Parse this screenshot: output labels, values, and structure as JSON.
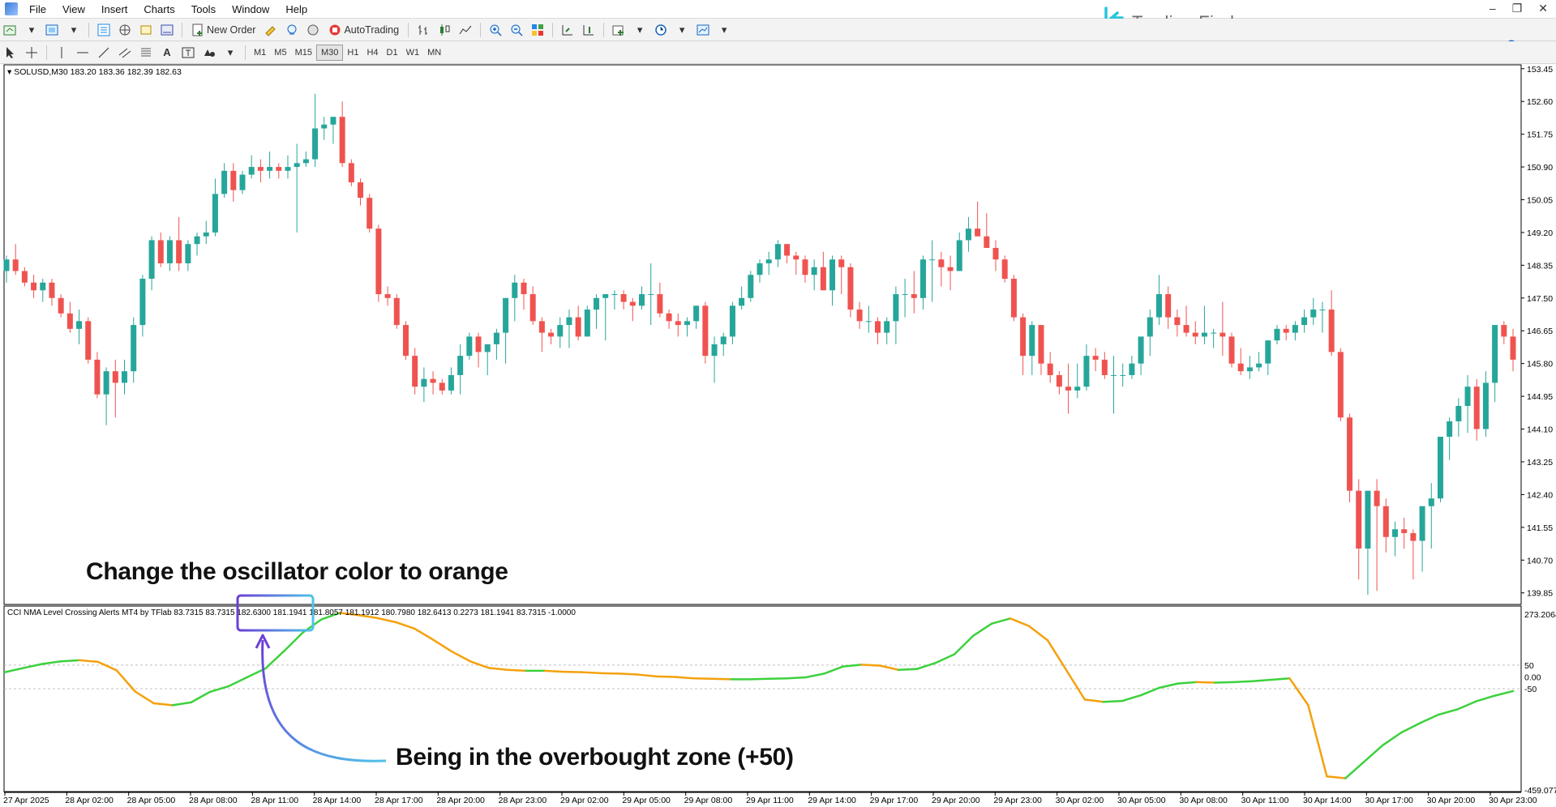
{
  "menu": {
    "items": [
      "File",
      "View",
      "Insert",
      "Charts",
      "Tools",
      "Window",
      "Help"
    ],
    "window_controls": [
      "–",
      "❐",
      "✕"
    ]
  },
  "toolbar": {
    "new_order_label": "New Order",
    "autotrading_label": "AutoTrading",
    "timeframes": [
      "M1",
      "M5",
      "M15",
      "M30",
      "H1",
      "H4",
      "D1",
      "W1",
      "MN"
    ],
    "active_timeframe": "M30"
  },
  "brand": {
    "name": "Trading Finder",
    "accent": "#26c6da"
  },
  "notifications": {
    "count": "1"
  },
  "chart_data": [
    {
      "type": "candlestick",
      "header": "SOLUSD,M30  183.20 183.36 182.39 182.63",
      "price_ticks": [
        "153.45",
        "152.60",
        "151.75",
        "150.90",
        "150.05",
        "149.20",
        "148.35",
        "147.50",
        "146.65",
        "145.80",
        "144.95",
        "144.10",
        "143.25",
        "142.40",
        "141.55",
        "140.70",
        "139.85"
      ],
      "ylim": [
        139.55,
        153.55
      ],
      "colors": {
        "up": "#26a69a",
        "down": "#ef5350"
      },
      "candles": [
        [
          148.2,
          148.6,
          147.9,
          148.5
        ],
        [
          148.5,
          148.9,
          148.1,
          148.2
        ],
        [
          148.2,
          148.3,
          147.8,
          147.9
        ],
        [
          147.9,
          148.1,
          147.5,
          147.7
        ],
        [
          147.7,
          148.0,
          147.4,
          147.9
        ],
        [
          147.9,
          148.0,
          147.3,
          147.5
        ],
        [
          147.5,
          147.6,
          147.0,
          147.1
        ],
        [
          147.1,
          147.4,
          146.6,
          146.7
        ],
        [
          146.7,
          147.2,
          146.3,
          146.9
        ],
        [
          146.9,
          147.0,
          145.8,
          145.9
        ],
        [
          145.9,
          146.1,
          144.9,
          145.0
        ],
        [
          145.0,
          145.7,
          144.2,
          145.6
        ],
        [
          145.6,
          145.9,
          144.4,
          145.3
        ],
        [
          145.3,
          145.9,
          145.0,
          145.6
        ],
        [
          145.6,
          147.0,
          145.3,
          146.8
        ],
        [
          146.8,
          148.1,
          146.5,
          148.0
        ],
        [
          148.0,
          149.1,
          147.7,
          149.0
        ],
        [
          149.0,
          149.2,
          148.3,
          148.4
        ],
        [
          148.4,
          149.1,
          148.2,
          149.0
        ],
        [
          149.0,
          149.6,
          148.2,
          148.4
        ],
        [
          148.4,
          149.0,
          148.2,
          148.9
        ],
        [
          148.9,
          149.2,
          148.6,
          149.1
        ],
        [
          149.1,
          149.5,
          148.9,
          149.2
        ],
        [
          149.2,
          150.6,
          149.1,
          150.2
        ],
        [
          150.2,
          151.0,
          150.1,
          150.8
        ],
        [
          150.8,
          151.0,
          150.0,
          150.3
        ],
        [
          150.3,
          150.8,
          150.2,
          150.7
        ],
        [
          150.7,
          151.2,
          150.6,
          150.9
        ],
        [
          150.9,
          151.1,
          150.5,
          150.8
        ],
        [
          150.8,
          151.3,
          150.6,
          150.9
        ],
        [
          150.9,
          151.0,
          150.6,
          150.8
        ],
        [
          150.8,
          151.2,
          150.6,
          150.9
        ],
        [
          150.9,
          151.5,
          149.2,
          151.0
        ],
        [
          151.0,
          151.3,
          150.9,
          151.1
        ],
        [
          151.1,
          152.8,
          150.9,
          151.9
        ],
        [
          151.9,
          152.2,
          151.6,
          152.0
        ],
        [
          152.0,
          152.2,
          151.5,
          152.2
        ],
        [
          152.2,
          152.6,
          150.9,
          151.0
        ],
        [
          151.0,
          151.1,
          150.4,
          150.5
        ],
        [
          150.5,
          150.6,
          149.9,
          150.1
        ],
        [
          150.1,
          150.2,
          149.2,
          149.3
        ],
        [
          149.3,
          149.4,
          147.4,
          147.6
        ],
        [
          147.6,
          147.8,
          147.3,
          147.5
        ],
        [
          147.5,
          147.6,
          146.7,
          146.8
        ],
        [
          146.8,
          146.9,
          145.9,
          146.0
        ],
        [
          146.0,
          146.2,
          145.0,
          145.2
        ],
        [
          145.2,
          145.7,
          144.8,
          145.4
        ],
        [
          145.4,
          145.6,
          145.0,
          145.3
        ],
        [
          145.3,
          145.4,
          145.0,
          145.1
        ],
        [
          145.1,
          145.7,
          145.0,
          145.5
        ],
        [
          145.5,
          146.3,
          145.0,
          146.0
        ],
        [
          146.0,
          146.6,
          145.9,
          146.5
        ],
        [
          146.5,
          146.6,
          145.7,
          146.1
        ],
        [
          146.1,
          146.3,
          145.5,
          146.3
        ],
        [
          146.3,
          146.7,
          145.9,
          146.6
        ],
        [
          146.6,
          147.5,
          145.8,
          147.5
        ],
        [
          147.5,
          148.1,
          146.9,
          147.9
        ],
        [
          147.9,
          148.0,
          147.2,
          147.6
        ],
        [
          147.6,
          147.8,
          146.8,
          146.9
        ],
        [
          146.9,
          147.0,
          146.1,
          146.6
        ],
        [
          146.6,
          146.7,
          146.3,
          146.5
        ],
        [
          146.5,
          147.0,
          146.2,
          146.8
        ],
        [
          146.8,
          147.2,
          146.2,
          147.0
        ],
        [
          147.0,
          147.3,
          146.4,
          146.5
        ],
        [
          146.5,
          147.3,
          146.5,
          147.2
        ],
        [
          147.2,
          147.6,
          146.7,
          147.5
        ],
        [
          147.5,
          147.6,
          146.4,
          147.6
        ],
        [
          147.6,
          147.7,
          147.2,
          147.6
        ],
        [
          147.6,
          147.7,
          147.2,
          147.4
        ],
        [
          147.4,
          147.5,
          146.9,
          147.3
        ],
        [
          147.3,
          147.8,
          147.2,
          147.6
        ],
        [
          147.6,
          148.4,
          146.8,
          147.6
        ],
        [
          147.6,
          147.9,
          147.0,
          147.1
        ],
        [
          147.1,
          147.2,
          146.7,
          146.9
        ],
        [
          146.9,
          147.1,
          146.5,
          146.8
        ],
        [
          146.8,
          147.0,
          146.5,
          146.9
        ],
        [
          146.9,
          147.3,
          146.7,
          147.3
        ],
        [
          147.3,
          147.4,
          145.8,
          146.0
        ],
        [
          146.0,
          146.5,
          145.3,
          146.3
        ],
        [
          146.3,
          146.6,
          146.0,
          146.5
        ],
        [
          146.5,
          147.4,
          146.3,
          147.3
        ],
        [
          147.3,
          147.8,
          147.2,
          147.5
        ],
        [
          147.5,
          148.2,
          147.4,
          148.1
        ],
        [
          148.1,
          148.5,
          147.9,
          148.4
        ],
        [
          148.4,
          148.7,
          148.1,
          148.5
        ],
        [
          148.5,
          149.0,
          148.3,
          148.9
        ],
        [
          148.9,
          148.9,
          148.4,
          148.6
        ],
        [
          148.6,
          148.7,
          148.1,
          148.5
        ],
        [
          148.5,
          148.6,
          147.9,
          148.1
        ],
        [
          148.1,
          148.5,
          147.7,
          148.3
        ],
        [
          148.3,
          148.7,
          147.7,
          147.7
        ],
        [
          147.7,
          148.6,
          147.3,
          148.5
        ],
        [
          148.5,
          148.6,
          147.6,
          148.3
        ],
        [
          148.3,
          148.4,
          147.0,
          147.2
        ],
        [
          147.2,
          147.4,
          146.7,
          146.9
        ],
        [
          146.9,
          147.3,
          146.6,
          146.9
        ],
        [
          146.9,
          147.0,
          146.3,
          146.6
        ],
        [
          146.6,
          147.0,
          146.3,
          146.9
        ],
        [
          146.9,
          147.8,
          146.3,
          147.6
        ],
        [
          147.6,
          148.0,
          147.0,
          147.6
        ],
        [
          147.6,
          148.2,
          147.1,
          147.5
        ],
        [
          147.5,
          148.6,
          147.2,
          148.5
        ],
        [
          148.5,
          149.0,
          147.4,
          148.5
        ],
        [
          148.5,
          148.7,
          147.8,
          148.3
        ],
        [
          148.3,
          148.6,
          147.7,
          148.2
        ],
        [
          148.2,
          149.2,
          148.2,
          149.0
        ],
        [
          149.0,
          149.6,
          148.7,
          149.3
        ],
        [
          149.3,
          150.0,
          149.1,
          149.1
        ],
        [
          149.1,
          149.7,
          148.8,
          148.8
        ],
        [
          148.8,
          149.0,
          148.2,
          148.5
        ],
        [
          148.5,
          148.6,
          147.9,
          148.0
        ],
        [
          148.0,
          148.1,
          146.9,
          147.0
        ],
        [
          147.0,
          147.1,
          145.5,
          146.0
        ],
        [
          146.0,
          146.9,
          145.5,
          146.8
        ],
        [
          146.8,
          146.8,
          145.5,
          145.8
        ],
        [
          145.8,
          146.1,
          145.3,
          145.5
        ],
        [
          145.5,
          145.6,
          145.0,
          145.2
        ],
        [
          145.2,
          145.8,
          144.5,
          145.1
        ],
        [
          145.1,
          145.8,
          144.9,
          145.2
        ],
        [
          145.2,
          146.3,
          145.1,
          146.0
        ],
        [
          146.0,
          146.2,
          145.6,
          145.9
        ],
        [
          145.9,
          146.1,
          145.4,
          145.5
        ],
        [
          145.5,
          146.0,
          144.5,
          145.5
        ],
        [
          145.5,
          145.8,
          145.2,
          145.5
        ],
        [
          145.5,
          146.0,
          145.4,
          145.8
        ],
        [
          145.8,
          146.2,
          145.5,
          146.5
        ],
        [
          146.5,
          147.2,
          146.0,
          147.0
        ],
        [
          147.0,
          148.1,
          146.8,
          147.6
        ],
        [
          147.6,
          147.8,
          146.7,
          147.0
        ],
        [
          147.0,
          147.2,
          146.5,
          146.8
        ],
        [
          146.8,
          147.3,
          146.5,
          146.6
        ],
        [
          146.6,
          146.9,
          146.3,
          146.5
        ],
        [
          146.5,
          147.3,
          146.3,
          146.6
        ],
        [
          146.6,
          146.7,
          146.2,
          146.6
        ],
        [
          146.6,
          147.4,
          146.0,
          146.5
        ],
        [
          146.5,
          146.6,
          145.7,
          145.8
        ],
        [
          145.8,
          146.2,
          145.5,
          145.6
        ],
        [
          145.6,
          146.0,
          145.4,
          145.7
        ],
        [
          145.7,
          146.1,
          145.6,
          145.8
        ],
        [
          145.8,
          146.4,
          145.5,
          146.4
        ],
        [
          146.4,
          146.8,
          146.3,
          146.7
        ],
        [
          146.7,
          146.8,
          146.4,
          146.6
        ],
        [
          146.6,
          146.9,
          146.4,
          146.8
        ],
        [
          146.8,
          147.2,
          146.6,
          147.0
        ],
        [
          147.0,
          147.5,
          146.8,
          147.2
        ],
        [
          147.2,
          147.4,
          146.6,
          147.2
        ],
        [
          147.2,
          147.7,
          146.0,
          146.1
        ],
        [
          146.1,
          146.2,
          144.3,
          144.4
        ],
        [
          144.4,
          144.5,
          142.2,
          142.5
        ],
        [
          142.5,
          142.8,
          140.2,
          141.0
        ],
        [
          141.0,
          142.2,
          139.8,
          142.5
        ],
        [
          142.5,
          142.8,
          139.9,
          142.1
        ],
        [
          142.1,
          142.3,
          140.9,
          141.3
        ],
        [
          141.3,
          141.7,
          140.8,
          141.5
        ],
        [
          141.5,
          141.8,
          141.0,
          141.4
        ],
        [
          141.4,
          141.5,
          140.2,
          141.2
        ],
        [
          141.2,
          141.9,
          140.4,
          142.1
        ],
        [
          142.1,
          142.7,
          141.0,
          142.3
        ],
        [
          142.3,
          143.3,
          142.2,
          143.9
        ],
        [
          143.9,
          144.4,
          143.3,
          144.3
        ],
        [
          144.3,
          144.9,
          143.9,
          144.7
        ],
        [
          144.7,
          145.5,
          144.0,
          145.2
        ],
        [
          145.2,
          145.4,
          143.8,
          144.1
        ],
        [
          144.1,
          145.6,
          143.9,
          145.3
        ],
        [
          145.3,
          146.8,
          144.8,
          146.8
        ],
        [
          146.8,
          146.9,
          146.3,
          146.5
        ],
        [
          146.5,
          146.7,
          145.6,
          145.9
        ]
      ]
    },
    {
      "type": "line",
      "header": "CCI NMA Level Crossing Alerts MT4 by TFlab 83.7315 83.7315 182.6300 181.1941 181.8057 181.1912 180.7980 182.6413 0.2273 181.1941 83.7315 -1.0000",
      "ylim": [
        -459.077,
        273.2064
      ],
      "levels": [
        50,
        0.0,
        -50
      ],
      "level_labels": [
        "50",
        "0.00",
        "-50"
      ],
      "tick_labels": [
        "273.2064",
        "50",
        "0.00",
        "-50",
        "-459.077"
      ],
      "colors": {
        "rising": "#3dd13d",
        "falling": "#f4a10d"
      },
      "values": [
        20,
        38,
        55,
        66,
        71,
        64,
        28,
        -62,
        -112,
        -120,
        -108,
        -64,
        -40,
        -2,
        36,
        110,
        188,
        244,
        272,
        262,
        250,
        232,
        205,
        158,
        108,
        66,
        38,
        30,
        26,
        26,
        22,
        20,
        16,
        14,
        10,
        2,
        0,
        -6,
        -8,
        -10,
        -10,
        -8,
        -6,
        -2,
        14,
        44,
        52,
        48,
        30,
        34,
        60,
        96,
        174,
        226,
        248,
        216,
        156,
        30,
        -96,
        -106,
        -102,
        -78,
        -46,
        -28,
        -22,
        -24,
        -22,
        -18,
        -12,
        -6,
        -120,
        -422,
        -430,
        -360,
        -290,
        -236,
        -196,
        -160,
        -138,
        -104,
        -80,
        -60
      ]
    }
  ],
  "x_axis": [
    "27 Apr 2025",
    "28 Apr 02:00",
    "28 Apr 05:00",
    "28 Apr 08:00",
    "28 Apr 11:00",
    "28 Apr 14:00",
    "28 Apr 17:00",
    "28 Apr 20:00",
    "28 Apr 23:00",
    "29 Apr 02:00",
    "29 Apr 05:00",
    "29 Apr 08:00",
    "29 Apr 11:00",
    "29 Apr 14:00",
    "29 Apr 17:00",
    "29 Apr 20:00",
    "29 Apr 23:00",
    "30 Apr 02:00",
    "30 Apr 05:00",
    "30 Apr 08:00",
    "30 Apr 11:00",
    "30 Apr 14:00",
    "30 Apr 17:00",
    "30 Apr 20:00",
    "30 Apr 23:00"
  ],
  "annotations": {
    "oscillator_note": "Change the oscillator color to orange",
    "overbought_note": "Being in the overbought zone (+50)"
  }
}
